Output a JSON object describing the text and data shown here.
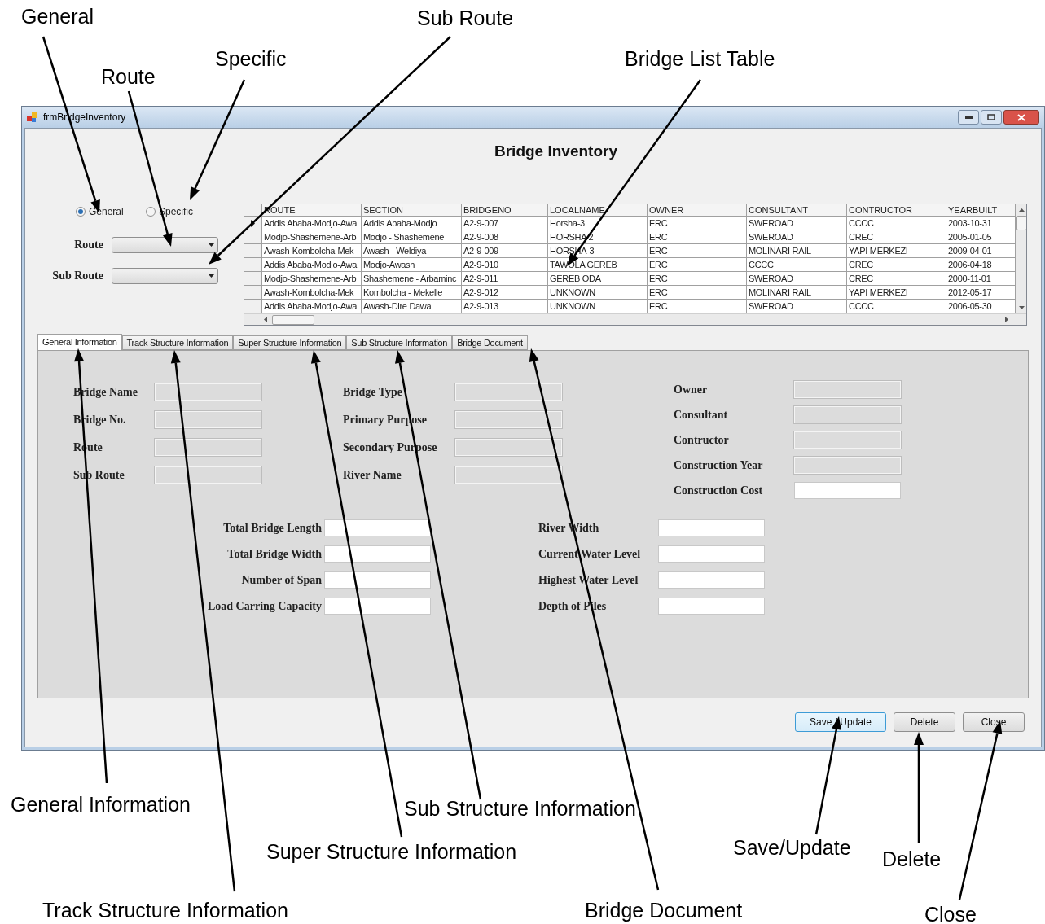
{
  "callouts": [
    {
      "label": "General"
    },
    {
      "label": "Route"
    },
    {
      "label": "Specific"
    },
    {
      "label": "Sub Route"
    },
    {
      "label": "Bridge List Table"
    },
    {
      "label": "General Information"
    },
    {
      "label": "Track Structure Information"
    },
    {
      "label": "Super Structure Information"
    },
    {
      "label": "Sub Structure Information"
    },
    {
      "label": "Bridge Document"
    },
    {
      "label": "Save/Update"
    },
    {
      "label": "Delete"
    },
    {
      "label": "Close"
    }
  ],
  "window": {
    "title": "frmBridgeInventory"
  },
  "heading": "Bridge Inventory",
  "mode_options": [
    {
      "label": "General",
      "selected": true
    },
    {
      "label": "Specific",
      "selected": false
    }
  ],
  "filters": [
    {
      "label": "Route"
    },
    {
      "label": "Sub Route"
    }
  ],
  "bridge_table": {
    "columns": [
      "ROUTE",
      "SECTION",
      "BRIDGENO",
      "LOCALNAME",
      "OWNER",
      "CONSULTANT",
      "CONTRUCTOR",
      "YEARBUILT"
    ],
    "rows": [
      {
        "selected": true,
        "cells": [
          "Addis Ababa-Modjo-Awa",
          "Addis Ababa-Modjo",
          "A2-9-007",
          "Horsha-3",
          "ERC",
          "SWEROAD",
          "CCCC",
          "2003-10-31"
        ]
      },
      {
        "selected": false,
        "cells": [
          "Modjo-Shashemene-Arb",
          "Modjo - Shashemene",
          "A2-9-008",
          "HORSHA 2",
          "ERC",
          "SWEROAD",
          "CREC",
          "2005-01-05"
        ]
      },
      {
        "selected": false,
        "cells": [
          "Awash-Kombolcha-Mek",
          "Awash - Weldiya",
          "A2-9-009",
          "HORSHA-3",
          "ERC",
          "MOLINARI RAIL",
          "YAPI MERKEZI",
          "2009-04-01"
        ]
      },
      {
        "selected": false,
        "cells": [
          "Addis Ababa-Modjo-Awa",
          "Modjo-Awash",
          "A2-9-010",
          "TAWOLA GEREB",
          "ERC",
          "CCCC",
          "CREC",
          "2006-04-18"
        ]
      },
      {
        "selected": false,
        "cells": [
          "Modjo-Shashemene-Arb",
          "Shashemene - Arbaminc",
          "A2-9-011",
          "GEREB ODA",
          "ERC",
          "SWEROAD",
          "CREC",
          "2000-11-01"
        ]
      },
      {
        "selected": false,
        "cells": [
          "Awash-Kombolcha-Mek",
          "Kombolcha - Mekelle",
          "A2-9-012",
          "UNKNOWN",
          "ERC",
          "MOLINARI RAIL",
          "YAPI MERKEZI",
          "2012-05-17"
        ]
      },
      {
        "selected": false,
        "cells": [
          "Addis Ababa-Modjo-Awa",
          "Awash-Dire Dawa",
          "A2-9-013",
          "UNKNOWN",
          "ERC",
          "SWEROAD",
          "CCCC",
          "2006-05-30"
        ]
      }
    ]
  },
  "tabs": [
    {
      "label": "General Information",
      "selected": true
    },
    {
      "label": "Track Structure Information",
      "selected": false
    },
    {
      "label": "Super Structure Information",
      "selected": false
    },
    {
      "label": "Sub Structure Information",
      "selected": false
    },
    {
      "label": "Bridge Document",
      "selected": false
    }
  ],
  "top_columns": [
    [
      {
        "label": "Bridge Name",
        "disabled": true
      },
      {
        "label": "Bridge No.",
        "disabled": true
      },
      {
        "label": "Route",
        "disabled": true
      },
      {
        "label": "Sub Route",
        "disabled": true
      }
    ],
    [
      {
        "label": "Bridge Type",
        "disabled": true
      },
      {
        "label": "Primary Purpose",
        "disabled": true
      },
      {
        "label": "Secondary Purpose",
        "disabled": true
      },
      {
        "label": "River Name",
        "disabled": true
      }
    ],
    [
      {
        "label": "Owner",
        "disabled": true
      },
      {
        "label": "Consultant",
        "disabled": true
      },
      {
        "label": "Contructor",
        "disabled": true
      },
      {
        "label": "Construction Year",
        "disabled": true
      },
      {
        "label": "Construction Cost",
        "disabled": false
      }
    ]
  ],
  "bottom_columns": [
    [
      {
        "label": "Total Bridge Length",
        "disabled": false
      },
      {
        "label": "Total Bridge Width",
        "disabled": false
      },
      {
        "label": "Number of Span",
        "disabled": false
      },
      {
        "label": "Load Carring Capacity",
        "disabled": false
      }
    ],
    [
      {
        "label": "River Width",
        "disabled": false
      },
      {
        "label": "Current Water Level",
        "disabled": false
      },
      {
        "label": "Highest Water Level",
        "disabled": false
      },
      {
        "label": "Depth of Piles",
        "disabled": false
      }
    ]
  ],
  "buttons": [
    {
      "label": "Save / Update",
      "focused": true
    },
    {
      "label": "Delete",
      "focused": false
    },
    {
      "label": "Close",
      "focused": false
    }
  ]
}
